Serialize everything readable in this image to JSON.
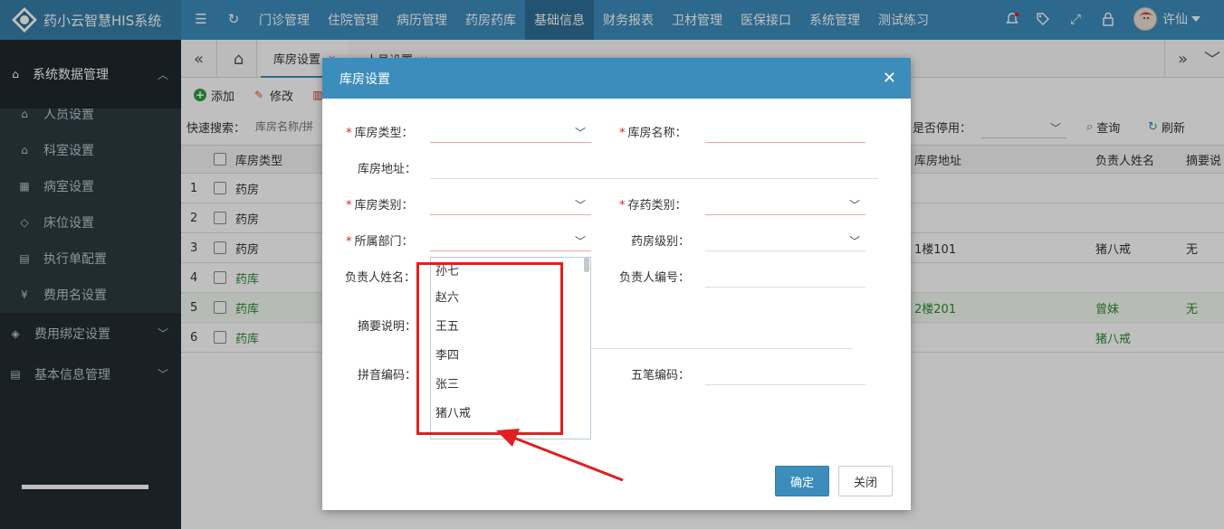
{
  "app": {
    "title": "药小云智慧HIS系统"
  },
  "topnav": {
    "items": [
      "门诊管理",
      "住院管理",
      "病历管理",
      "药房药库",
      "基础信息",
      "财务报表",
      "卫材管理",
      "医保接口",
      "系统管理",
      "测试练习"
    ],
    "active": "基础信息"
  },
  "user": {
    "name": "许仙"
  },
  "sidebar": {
    "group1": "系统数据管理",
    "items": [
      "人员设置",
      "科室设置",
      "病室设置",
      "床位设置",
      "执行单配置",
      "费用名设置"
    ],
    "group2": "费用绑定设置",
    "group3": "基本信息管理"
  },
  "tabs": {
    "items": [
      "库房设置",
      "人员设置"
    ]
  },
  "toolbar": {
    "add": "添加",
    "edit": "修改"
  },
  "search": {
    "label": "快速搜索：",
    "placeholder": "库房名称/拼",
    "stop_label": "是否停用：",
    "query": "查询",
    "refresh": "刷新"
  },
  "grid": {
    "headers": {
      "type": "库房类型",
      "address": "库房地址",
      "person": "负责人姓名",
      "summary": "摘要说"
    },
    "rows": [
      {
        "no": "1",
        "type": "药房",
        "address": "",
        "person": "",
        "summary": ""
      },
      {
        "no": "2",
        "type": "药房",
        "address": "",
        "person": "",
        "summary": ""
      },
      {
        "no": "3",
        "type": "药房",
        "address": "1楼101",
        "person": "猪八戒",
        "summary": "无"
      },
      {
        "no": "4",
        "type": "药库",
        "address": "",
        "person": "",
        "summary": ""
      },
      {
        "no": "5",
        "type": "药库",
        "address": "2楼201",
        "person": "曾妹",
        "summary": "无"
      },
      {
        "no": "6",
        "type": "药库",
        "address": "",
        "person": "猪八戒",
        "summary": ""
      }
    ]
  },
  "dialog": {
    "title": "库房设置",
    "fields": {
      "type": "库房类型：",
      "name": "库房名称：",
      "address": "库房地址：",
      "category": "库房类别：",
      "drug_type": "存药类别：",
      "dept": "所属部门：",
      "level": "药房级别：",
      "person_name": "负责人姓名：",
      "person_no": "负责人编号：",
      "summary": "摘要说明：",
      "pinyin": "拼音编码：",
      "wubi": "五笔编码："
    },
    "dropdown_options": [
      "孙七",
      "赵六",
      "王五",
      "李四",
      "张三",
      "猪八戒"
    ],
    "ok": "确定",
    "close": "关闭"
  },
  "colors": {
    "primary": "#3c8dbc",
    "sidebar": "#222d32",
    "highlight": "#e02020"
  },
  "icons": [
    "logo-icon",
    "menu-toggle-icon",
    "refresh-icon",
    "bell-icon",
    "tag-icon",
    "fullscreen-icon",
    "lock-icon",
    "home-icon",
    "close-icon",
    "chevron-down-icon"
  ]
}
